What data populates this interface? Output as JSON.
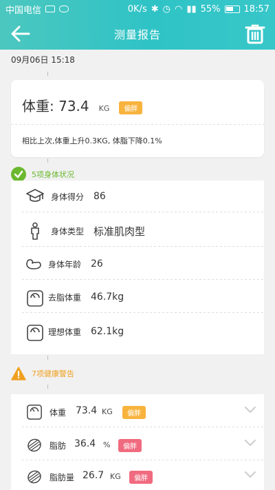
{
  "status_bar": {
    "carrier": "中国电信",
    "speed": "0K/s",
    "battery_pct": "55%",
    "time": "18:57"
  },
  "header": {
    "title": "测量报告"
  },
  "date": "09月06日 15:18",
  "weight_card": {
    "label": "体重: 73.4",
    "unit": "KG",
    "tag": "偏胖",
    "compare": "相比上次,体重上升0.3KG, 体脂下降0.1%"
  },
  "status_section": {
    "title": "5项身体状况",
    "items": [
      {
        "icon": "graduation-cap-icon",
        "label": "身体得分",
        "value": "86"
      },
      {
        "icon": "body-figure-icon",
        "label": "身体类型",
        "value": "标准肌肉型"
      },
      {
        "icon": "muscle-arm-icon",
        "label": "身体年龄",
        "value": "26"
      },
      {
        "icon": "scale-icon",
        "label": "去脂体重",
        "value": "46.7kg"
      },
      {
        "icon": "scale-icon",
        "label": "理想体重",
        "value": "62.1kg"
      }
    ]
  },
  "warning_section": {
    "title": "7项健康警告",
    "items": [
      {
        "icon": "scale-icon",
        "label": "体重",
        "value": "73.4",
        "unit": "KG",
        "tag": "偏胖",
        "tag_color": "#f8b33d"
      },
      {
        "icon": "fat-cell-icon",
        "label": "脂肪",
        "value": "36.4",
        "unit": "%",
        "tag": "偏胖",
        "tag_color": "#f06b7f"
      },
      {
        "icon": "fat-cell-icon",
        "label": "脂肪量",
        "value": "26.7",
        "unit": "KG",
        "tag": "偏胖",
        "tag_color": "#f06b7f"
      }
    ]
  },
  "colors": {
    "header_teal": "#2fc3c6",
    "tag_orange": "#f8b33d",
    "tag_red": "#f06b7f",
    "ok_green": "#6bb82f",
    "warn_orange": "#f0a020"
  }
}
